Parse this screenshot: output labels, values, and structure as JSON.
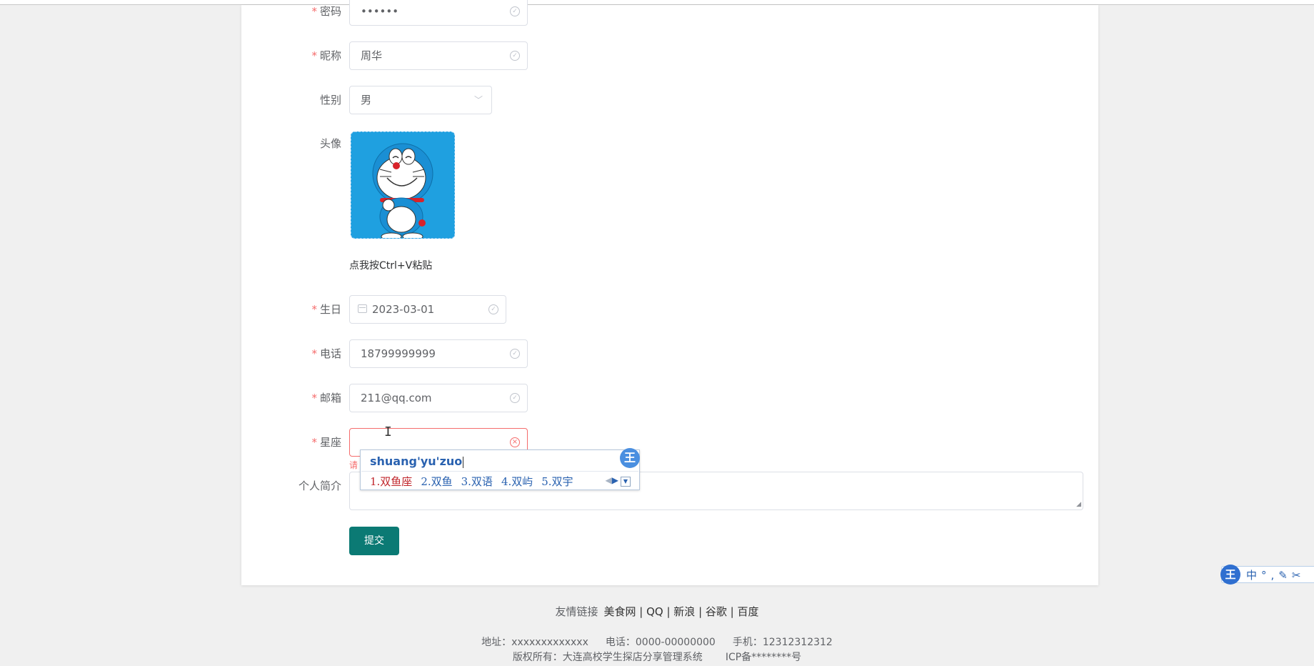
{
  "form": {
    "password": {
      "label": "密码",
      "value": "••••••"
    },
    "nickname": {
      "label": "昵称",
      "value": "周华"
    },
    "gender": {
      "label": "性别",
      "value": "男"
    },
    "avatar": {
      "label": "头像",
      "paste_hint": "点我按Ctrl+V粘贴"
    },
    "birthday": {
      "label": "生日",
      "value": "2023-03-01"
    },
    "phone": {
      "label": "电话",
      "value": "18799999999"
    },
    "email": {
      "label": "邮箱",
      "value": "211@qq.com"
    },
    "constellation": {
      "label": "星座",
      "value": "",
      "error_tip": "请"
    },
    "bio": {
      "label": "个人简介",
      "value": ""
    },
    "submit_label": "提交"
  },
  "ime": {
    "composition": "shuang'yu'zuo",
    "candidates": [
      "1.双鱼座",
      "2.双鱼",
      "3.双语",
      "4.双屿",
      "5.双宇"
    ],
    "badge": "王",
    "toolbar_logo": "王",
    "toolbar_items": "中°,✎✂"
  },
  "footer": {
    "links_label": "友情链接",
    "links": "美食网 | QQ | 新浪 | 谷歌 | 百度",
    "address": "地址：xxxxxxxxxxxxx",
    "tel": "电话：0000-00000000",
    "mobile": "手机：12312312312",
    "copyright": "版权所有：大连高校学生探店分享管理系统",
    "icp": "ICP备********号"
  },
  "colors": {
    "primary": "#0b7a74",
    "error": "#f56c6c",
    "ime_blue": "#2a62b0",
    "ime_red": "#c0262c"
  }
}
